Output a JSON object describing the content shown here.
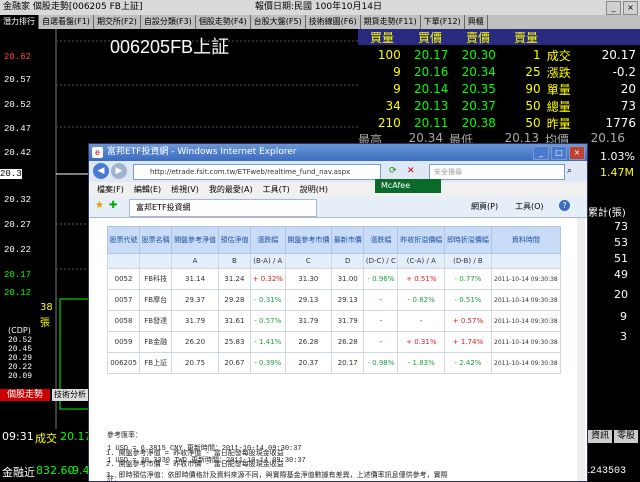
{
  "window": {
    "title": "金融家  個股走勢[006205 FB上証]",
    "date_label": "報價日期:民國 100年10月14日"
  },
  "tabs": [
    {
      "label": "潛力排行",
      "active": true
    },
    {
      "label": "自選看盤(F1)",
      "active": false
    },
    {
      "label": "期交所(F2)",
      "active": false
    },
    {
      "label": "自設分類(F3)",
      "active": false
    },
    {
      "label": "個股走勢(F4)",
      "active": false
    },
    {
      "label": "台股大盤(F5)",
      "active": false
    },
    {
      "label": "技術線圖(F6)",
      "active": false
    },
    {
      "label": "期貨走勢(F11)",
      "active": false
    },
    {
      "label": "下單(F12)",
      "active": false
    },
    {
      "label": "興櫃",
      "active": false
    }
  ],
  "chart": {
    "title": "006205FB上証",
    "y_labels": [
      "20.62",
      "20.57",
      "20.52",
      "20.47",
      "20.42",
      "20.37",
      "20.32",
      "20.27",
      "20.22",
      "20.17",
      "20.12"
    ],
    "current": "20.37",
    "left_info": [
      "38",
      "張",
      "(CDP)",
      "20.52",
      "20.45",
      "20.29",
      "20.22",
      "20.09"
    ],
    "bottom_time": "09:31",
    "bottom_label": "成交",
    "bottom_value": "20.17",
    "bottom_btn1": "個股走勢",
    "bottom_btn2": "技術分析",
    "ticker_label": "金融近",
    "ticker_value": "832.60",
    "ticker_change": "-9.4"
  },
  "quote": {
    "headers": [
      "買量",
      "買價",
      "賣價",
      "賣量"
    ],
    "rows": [
      {
        "bv": "100",
        "bp": "20.17",
        "sp": "20.30",
        "sv": "1",
        "label": "成交",
        "val": "20.17"
      },
      {
        "bv": "9",
        "bp": "20.16",
        "sp": "20.34",
        "sv": "25",
        "label": "漲跌",
        "val": "-0.2"
      },
      {
        "bv": "9",
        "bp": "20.14",
        "sp": "20.35",
        "sv": "90",
        "label": "單量",
        "val": "20"
      },
      {
        "bv": "34",
        "bp": "20.13",
        "sp": "20.37",
        "sv": "50",
        "label": "總量",
        "val": "73"
      },
      {
        "bv": "210",
        "bp": "20.11",
        "sp": "20.38",
        "sv": "50",
        "label": "昨量",
        "val": "1776"
      }
    ],
    "partial_row": {
      "a": "最高",
      "b": "20.34",
      "c": "最低",
      "d": "20.13",
      "e": "均價",
      "f": "20.16"
    },
    "side_values": [
      "1.03%",
      "1.47M"
    ],
    "side_label": "累計(張)",
    "side_list": [
      "73",
      "53",
      "51",
      "49",
      "20",
      "9",
      "3"
    ],
    "side_btn1": "資訊",
    "side_btn2": "零股"
  },
  "ie": {
    "title": "富邦ETF投資網 - Windows Internet Explorer",
    "address": "http://etrade.fsit.com.tw/ETFweb/realtime_fund_nav.aspx",
    "search_placeholder": "安全搜尋",
    "menu": [
      "檔案(F)",
      "編輯(E)",
      "檢視(V)",
      "我的最愛(A)",
      "工具(T)",
      "說明(H)"
    ],
    "tab_label": "富邦ETF投資網",
    "toolbar_mcafee": "McAfee",
    "toolbar_page": "網頁(P)",
    "toolbar_tools": "工具(O)",
    "table_headers": [
      "股票代號",
      "股票名稱",
      "開盤參考淨值",
      "預估淨值",
      "漲跌幅",
      "開盤參考市價",
      "最新市價",
      "漲跌幅",
      "昨收折溢價幅",
      "即時折溢價幅",
      "資料時間"
    ],
    "sub_headers": [
      "",
      "",
      "A",
      "B",
      "(B-A) / A",
      "C",
      "D",
      "(D-C) / C",
      "(C-A) / A",
      "(D-B) / B",
      ""
    ],
    "rows": [
      [
        "0052",
        "FB科技",
        "31.14",
        "31.24",
        "+ 0.32%",
        "31.30",
        "31.00",
        "- 0.96%",
        "+ 0.51%",
        "- 0.77%",
        "2011-10-14 09:30:38"
      ],
      [
        "0057",
        "FB摩台",
        "29.37",
        "29.28",
        "- 0.31%",
        "29.13",
        "29.13",
        "-",
        "- 0.82%",
        "- 0.51%",
        "2011-10-14 09:30:38"
      ],
      [
        "0058",
        "FB發達",
        "31.79",
        "31.61",
        "- 0.57%",
        "31.79",
        "31.79",
        "-",
        "-",
        "+ 0.57%",
        "2011-10-14 09:30:38"
      ],
      [
        "0059",
        "FB金融",
        "26.20",
        "25.83",
        "- 1.41%",
        "26.28",
        "26.28",
        "-",
        "+ 0.31%",
        "+ 1.74%",
        "2011-10-14 09:30:38"
      ],
      [
        "006205",
        "FB上証",
        "20.75",
        "20.67",
        "- 0.39%",
        "20.37",
        "20.17",
        "- 0.98%",
        "- 1.83%",
        "- 2.42%",
        "2011-10-14 09:30:38"
      ]
    ],
    "rate_title": "參考匯率：",
    "rate1": "1 USD = 6.3815 CNY 更新時間：2011-10-14 09:30:37",
    "rate2": "1 USD = 30.3330 TWD 更新時間：2011-10-14 09:30:37",
    "notes_title": "註：",
    "notes": [
      "1.    開盤參考淨值 = 昨收淨值 - 當日配發每股現金收益",
      "2.    開盤參考市價 = 昨收市價 - 當日配發每股現金收益",
      "3.    即時預估淨值：依即時價格計及資料來源不同，與實際基金淨值數據有差異，上述價率訊息僅供參考，實際"
    ]
  },
  "watermark": "#1243503",
  "colors": {
    "accent_yellow": "#ffff00",
    "ie_blue": "#3a6cc0",
    "up_red": "#e02020",
    "down_green": "#20a040"
  }
}
